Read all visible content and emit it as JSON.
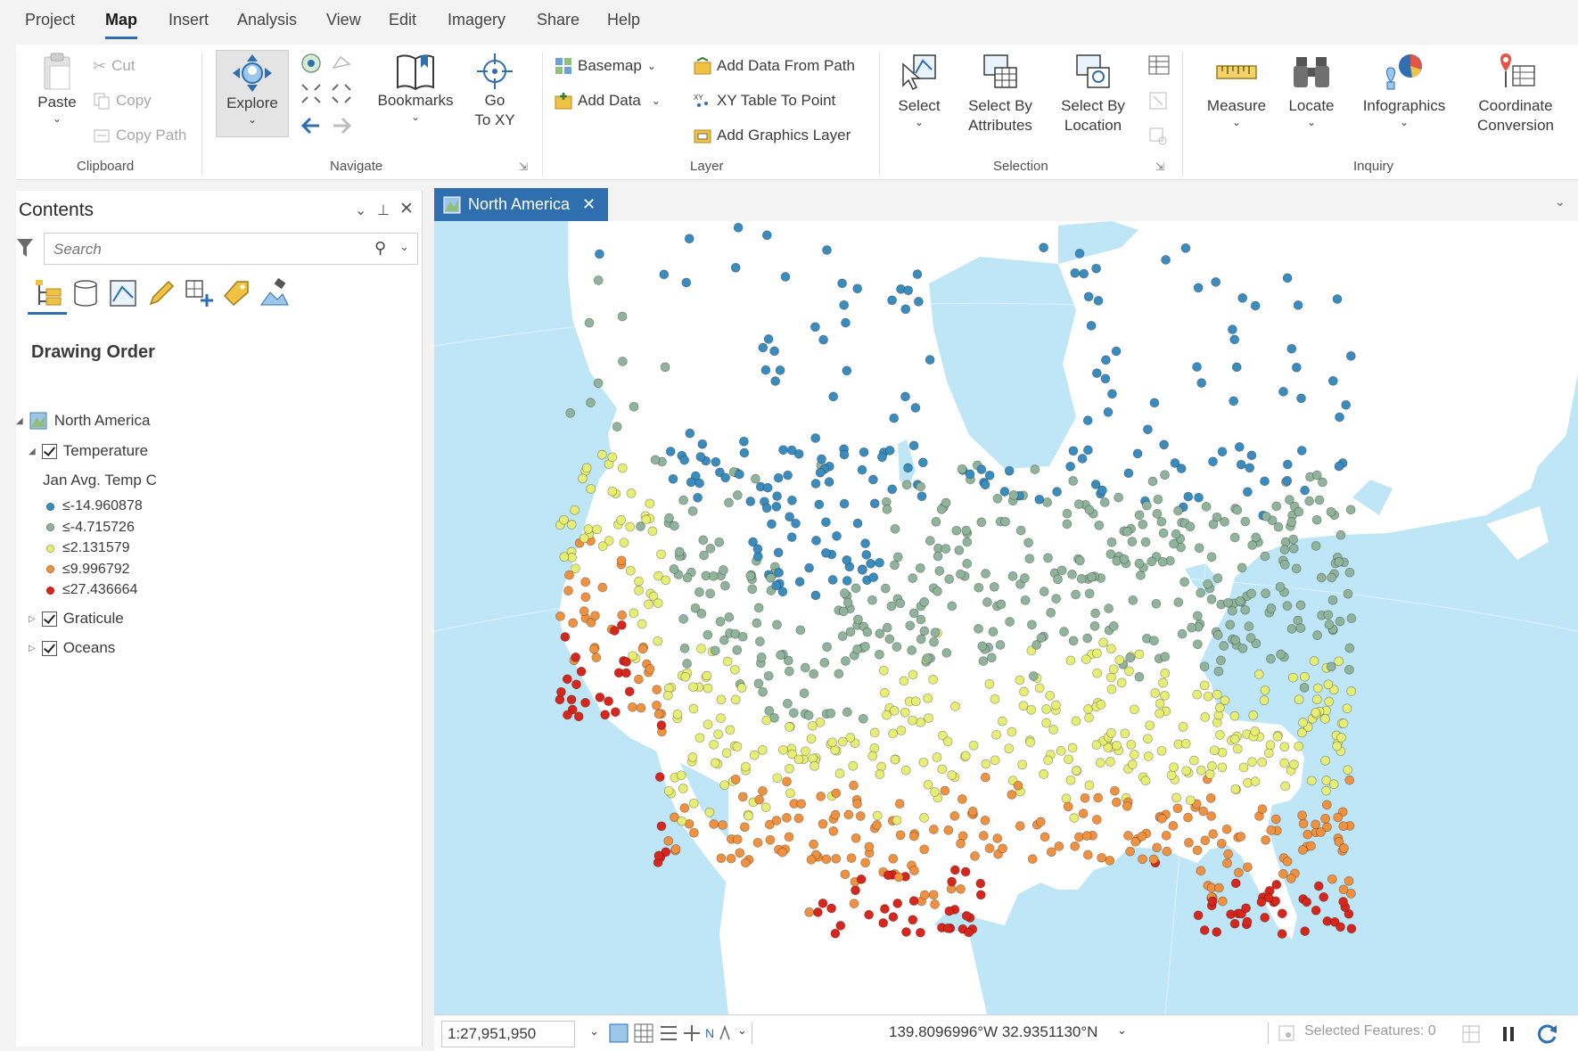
{
  "menu": {
    "tabs": [
      "Project",
      "Map",
      "Insert",
      "Analysis",
      "View",
      "Edit",
      "Imagery",
      "Share",
      "Help"
    ],
    "active": "Map"
  },
  "ribbon": {
    "clipboard": {
      "paste": "Paste",
      "cut": "Cut",
      "copy": "Copy",
      "copy_path": "Copy Path",
      "group": "Clipboard"
    },
    "navigate": {
      "explore": "Explore",
      "bookmarks": "Bookmarks",
      "goto_1": "Go",
      "goto_2": "To XY",
      "group": "Navigate"
    },
    "layer": {
      "basemap": "Basemap",
      "add_data": "Add Data",
      "add_data_path": "Add Data From Path",
      "xy_table": "XY Table To Point",
      "add_graphics": "Add Graphics Layer",
      "group": "Layer"
    },
    "selection": {
      "select": "Select",
      "by_attr_1": "Select By",
      "by_attr_2": "Attributes",
      "by_loc_1": "Select By",
      "by_loc_2": "Location",
      "group": "Selection"
    },
    "inquiry": {
      "measure": "Measure",
      "locate": "Locate",
      "infographics": "Infographics",
      "coord_1": "Coordinate",
      "coord_2": "Conversion",
      "group": "Inquiry"
    }
  },
  "contents": {
    "title": "Contents",
    "search_placeholder": "Search",
    "drawing_order": "Drawing Order",
    "map_name": "North America",
    "layers": {
      "temperature": "Temperature",
      "field": "Jan Avg. Temp C",
      "classes": [
        {
          "label": "≤-14.960878",
          "color": "#3a8cbf"
        },
        {
          "label": "≤-4.715726",
          "color": "#8fb39b"
        },
        {
          "label": "≤2.131579",
          "color": "#e6ee74"
        },
        {
          "label": "≤9.996792",
          "color": "#f0913f"
        },
        {
          "label": "≤27.436664",
          "color": "#d7261c"
        }
      ],
      "graticule": "Graticule",
      "oceans": "Oceans"
    }
  },
  "map_view": {
    "tab_title": "North America",
    "ocean_color": "#bfe6f7",
    "land_color": "#ffffff"
  },
  "status": {
    "scale": "1:27,951,950",
    "coordinates": "139.8096996°W 32.9351130°N",
    "selected": "Selected Features: 0"
  }
}
